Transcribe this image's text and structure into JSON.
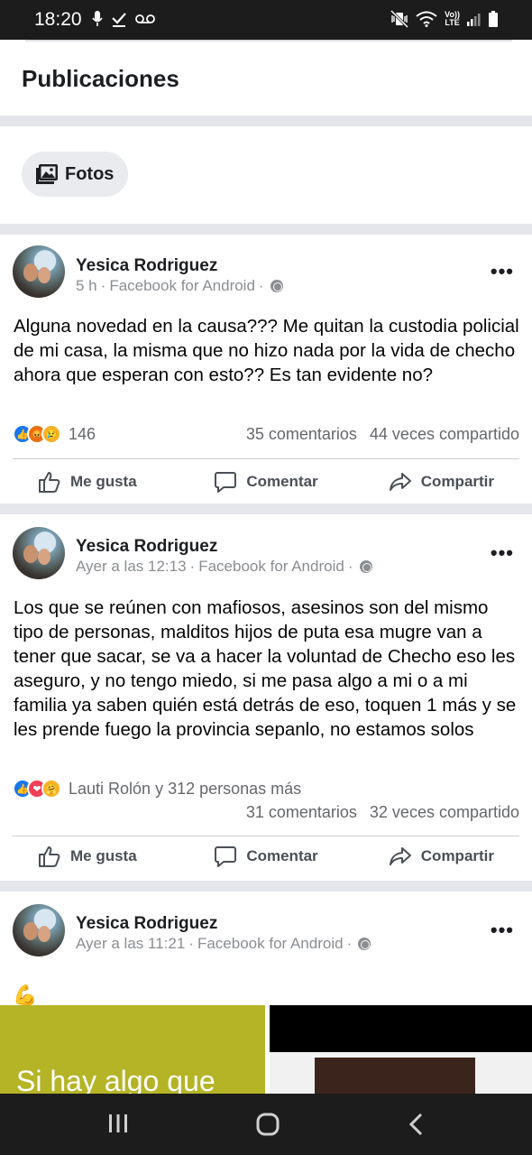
{
  "status_bar": {
    "time": "18:20",
    "left_icons": [
      "mic-icon",
      "check-icon",
      "voicemail-icon"
    ],
    "right_icons": [
      "mute-vibrate-icon",
      "wifi-icon",
      "volte-lte-icon",
      "signal-icon",
      "battery-icon"
    ],
    "volte": "Vo))",
    "lte": "LTE"
  },
  "header": {
    "title": "Publicaciones"
  },
  "filter": {
    "fotos_label": "Fotos",
    "fotos_icon": "photo-icon"
  },
  "posts": [
    {
      "author": "Yesica Rodriguez",
      "time": "5 h",
      "source": "Facebook for Android",
      "text": "Alguna novedad en la causa??? Me quitan la custodia policial de mi casa, la misma que no hizo nada por la vida de checho ahora que esperan con esto?? Es tan evidente no?",
      "reactions": [
        "like",
        "angry",
        "sad"
      ],
      "reaction_count": "146",
      "comments": "35 comentarios",
      "shares": "44 veces compartido"
    },
    {
      "author": "Yesica Rodriguez",
      "time": "Ayer a las 12:13",
      "source": "Facebook for Android",
      "text": "Los que se reúnen con mafiosos, asesinos son del mismo tipo de personas, malditos hijos de puta esa mugre van a tener que sacar, se va a hacer la voluntad de Checho eso les aseguro, y no tengo miedo, si me pasa algo a mi o a mi familia ya saben quién está detrás de eso, toquen 1 más y se les prende fuego la provincia sepanlo, no estamos solos",
      "reactions": [
        "like",
        "love",
        "care"
      ],
      "reaction_count": "Lauti Rolón y 312 personas más",
      "comments": "31 comentarios",
      "shares": "32 veces compartido"
    },
    {
      "author": "Yesica Rodriguez",
      "time": "Ayer a las 11:21",
      "source": "Facebook for Android",
      "text": "💪",
      "image_text": "Si hay algo que"
    }
  ],
  "actions": {
    "like": "Me gusta",
    "comment": "Comentar",
    "share": "Compartir"
  },
  "separator": "·",
  "more": "•••",
  "nav_bar": [
    "recents-icon",
    "home-icon",
    "back-icon"
  ],
  "colors": {
    "accent": "#1877f2",
    "separator": "#e4e6eb",
    "meta_text": "#8a8d91"
  }
}
